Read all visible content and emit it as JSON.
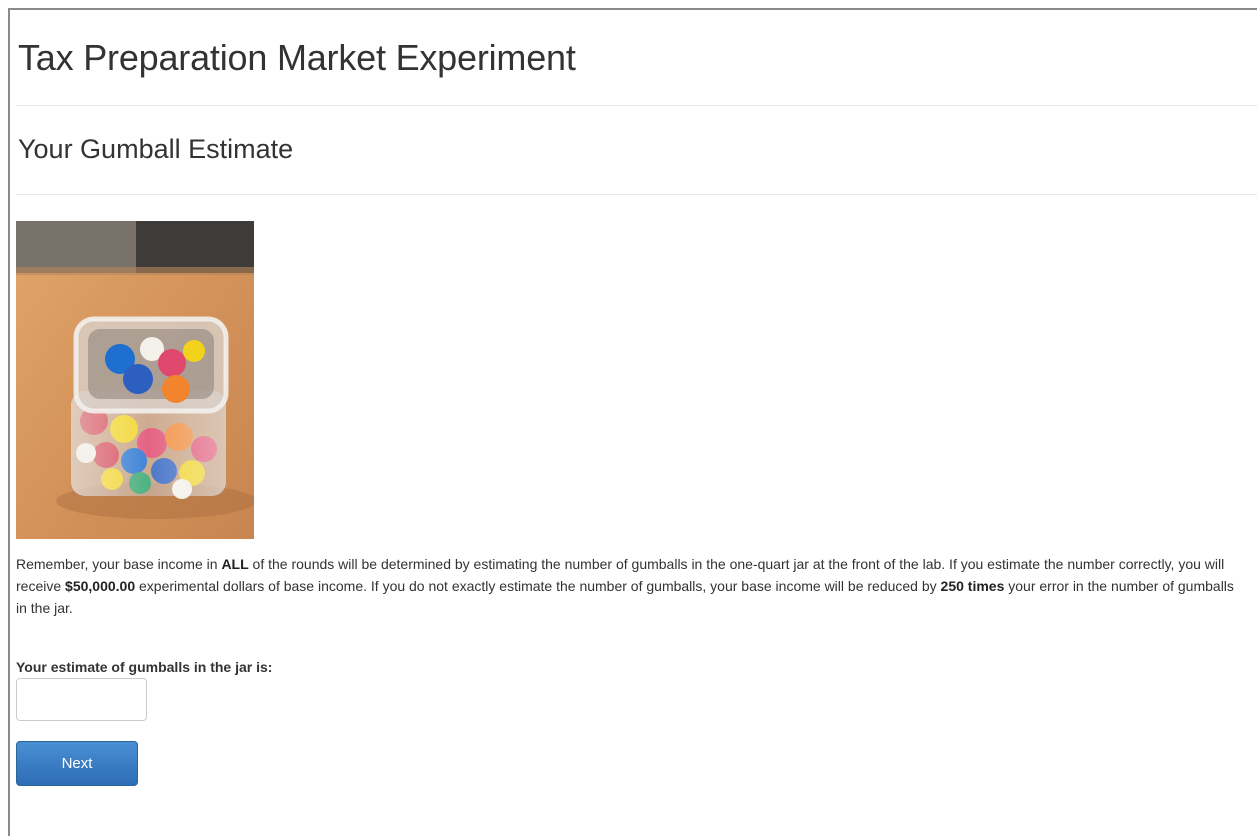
{
  "header": {
    "title": "Tax Preparation Market Experiment"
  },
  "page": {
    "section_title": "Your Gumball Estimate"
  },
  "instructions": {
    "t1": "Remember, your base income in ",
    "b1": "ALL",
    "t2": " of the rounds will be determined by estimating the number of gumballs in the one-quart jar at the front of the lab. If you estimate the number correctly, you will receive ",
    "b2": "$50,000.00",
    "t3": " experimental dollars of base income. If you do not exactly estimate the number of gumballs, your base income will be reduced by ",
    "b3": "250 times",
    "t4": " your error in the number of gumballs in the jar."
  },
  "form": {
    "estimate_label": "Your estimate of gumballs in the jar is:",
    "estimate_value": "",
    "next_label": "Next"
  },
  "colors": {
    "button_top": "#4a8fd3",
    "button_bottom": "#2d6db5",
    "table_wood": "#d89a5e",
    "wall": "#6f6a63"
  },
  "icons": {
    "photo": "gumball-jar-photo"
  }
}
